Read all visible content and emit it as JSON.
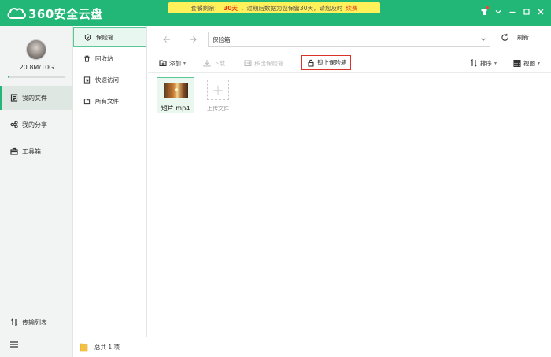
{
  "app": {
    "logo_text": "360安全云盘",
    "brand_color": "#23b777"
  },
  "notice": {
    "prefix": "套餐剩余：",
    "days": "30天",
    "middle": "，过期后数据为您保留30天，请您及时",
    "renew": "续费"
  },
  "user": {
    "quota": "20.8M/10G",
    "quota_fraction": 0.02
  },
  "leftnav": {
    "items": [
      {
        "label": "我的文件",
        "icon": "file-icon"
      },
      {
        "label": "我的分享",
        "icon": "share-icon"
      },
      {
        "label": "工具箱",
        "icon": "toolbox-icon"
      }
    ],
    "transfer_label": "传输列表",
    "menu_icon": "menu-icon"
  },
  "categories": [
    {
      "label": "保险箱",
      "icon": "shield-icon"
    },
    {
      "label": "回收站",
      "icon": "trash-icon"
    },
    {
      "label": "快速访问",
      "icon": "pin-icon"
    },
    {
      "label": "所有文件",
      "icon": "folder-icon"
    }
  ],
  "address": {
    "path": "保险箱",
    "refresh_label": "刷新"
  },
  "toolbar": {
    "add_label": "添加",
    "download_label": "下载",
    "move_out_label": "移出保险箱",
    "lock_label": "锁上保险箱",
    "sort_label": "排序",
    "view_label": "视图"
  },
  "files": [
    {
      "name": "短片.mp4",
      "type": "video"
    }
  ],
  "upload_label": "上传文件",
  "status": {
    "total": "总共 1 项"
  }
}
